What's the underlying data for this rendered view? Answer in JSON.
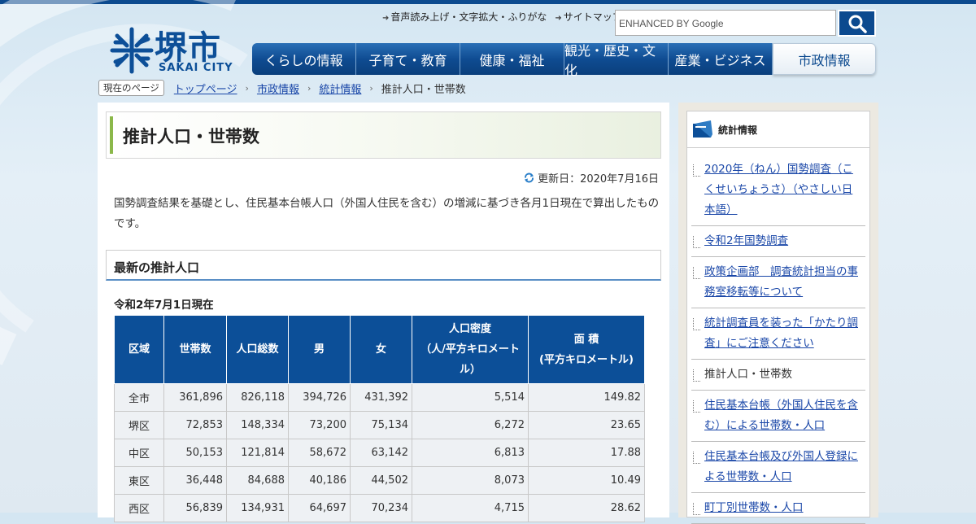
{
  "logo": {
    "kanji": "堺市",
    "en": "SAKAI CITY"
  },
  "utility_links": [
    "音声読み上げ・文字拡大・ふりがな",
    "サイトマップ"
  ],
  "search": {
    "placeholder": "ENHANCED BY Google"
  },
  "nav": [
    "くらしの情報",
    "子育て・教育",
    "健康・福祉",
    "観光・歴史・文化",
    "産業・ビジネス",
    "市政情報"
  ],
  "breadcrumb": {
    "label": "現在のページ",
    "links": [
      "トップページ",
      "市政情報",
      "統計情報"
    ],
    "current": "推計人口・世帯数"
  },
  "page": {
    "title": "推計人口・世帯数",
    "updated": "更新日：2020年7月16日",
    "intro": "国勢調査結果を基礎とし、住民基本台帳人口（外国人住民を含む）の増減に基づき各月1日現在で算出したものです。",
    "section_title": "最新の推計人口",
    "as_of": "令和2年7月1日現在"
  },
  "table": {
    "headers": [
      "区域",
      "世帯数",
      "人口総数",
      "男",
      "女",
      "人口密度\n（人/平方キロメートル）",
      "面 積\n(平方キロメートル)"
    ],
    "header_h1": [
      "区域",
      "世帯数",
      "人口総数",
      "男",
      "女"
    ],
    "density_lines": [
      "人口密度",
      "（人/平方キロメート",
      "ル）"
    ],
    "area_lines": [
      "面 積",
      "(平方キロメートル)"
    ],
    "rows": [
      [
        "全市",
        "361,896",
        "826,118",
        "394,726",
        "431,392",
        "5,514",
        "149.82"
      ],
      [
        "堺区",
        "72,853",
        "148,334",
        "73,200",
        "75,134",
        "6,272",
        "23.65"
      ],
      [
        "中区",
        "50,153",
        "121,814",
        "58,672",
        "63,142",
        "6,813",
        "17.88"
      ],
      [
        "東区",
        "36,448",
        "84,688",
        "40,186",
        "44,502",
        "8,073",
        "10.49"
      ],
      [
        "西区",
        "56,839",
        "134,931",
        "64,697",
        "70,234",
        "4,715",
        "28.62"
      ]
    ]
  },
  "sidebar": {
    "title": "統計情報",
    "items": [
      {
        "label": "2020年（ねん）国勢調査（こくせいちょうさ）（やさしい日本語）",
        "current": false
      },
      {
        "label": "令和2年国勢調査",
        "current": false
      },
      {
        "label": "政策企画部　調査統計担当の事務室移転等について",
        "current": false
      },
      {
        "label": "統計調査員を装った「かたり調査」にご注意ください",
        "current": false
      },
      {
        "label": "推計人口・世帯数",
        "current": true
      },
      {
        "label": "住民基本台帳（外国人住民を含む）による世帯数・人口",
        "current": false
      },
      {
        "label": "住民基本台帳及び外国人登録による世帯数・人口",
        "current": false
      },
      {
        "label": "町丁別世帯数・人口",
        "current": false
      }
    ]
  },
  "colors": {
    "brand": "#0c4a8f",
    "accent_green": "#8bb84a",
    "link": "#1a47a8"
  }
}
